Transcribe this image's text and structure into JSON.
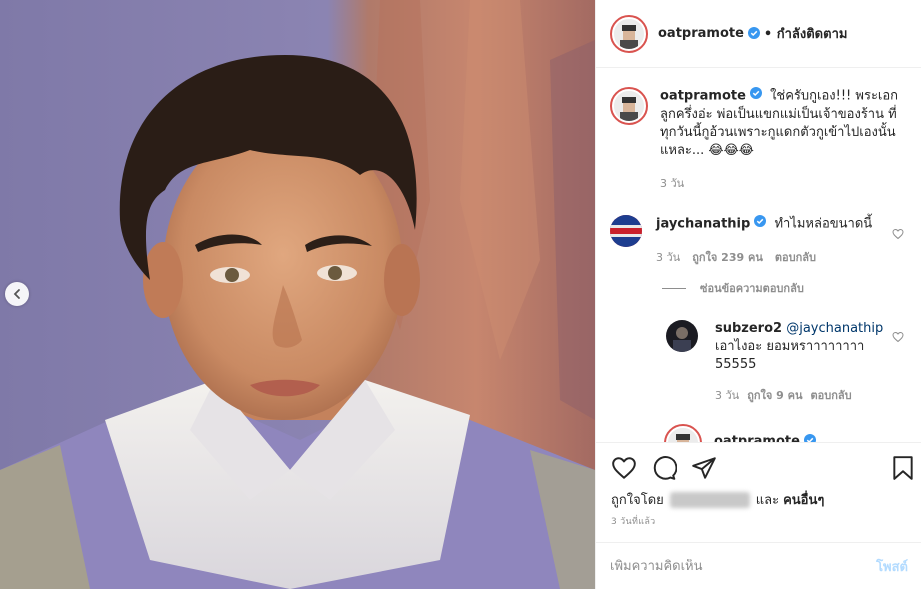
{
  "post": {
    "author": "oatpramote",
    "follow_state": "• กำลังติดตาม",
    "caption": "ใช่ครับกูเอง!!! พระเอกลูกครึ่งอ่ะ พ่อเป็นแขกแม่เป็นเจ้าของร้าน ที่ทุกวันนี้กูอ้วนเพราะกูแดกตัวกูเข้าไปเองนั้นแหละ... 😂😂😂",
    "caption_age": "3 วัน",
    "likes_prefix": "ถูกใจโดย",
    "likes_suffix": "และ",
    "likes_others": "คนอื่นๆ",
    "post_time": "3 วันที่แล้ว"
  },
  "comments": [
    {
      "user": "jaychanathip",
      "text": "ทำไมหล่อขนาดนี้",
      "age": "3 วัน",
      "likes": "ถูกใจ 239 คน",
      "reply": "ตอบกลับ"
    }
  ],
  "hide_replies": "ซ่อนข้อความตอบกลับ",
  "replies": [
    {
      "user": "subzero2",
      "mention": "@jaychanathip",
      "text": "เอาไงอะ ยอมหราาาาาาาา 55555",
      "age": "3 วัน",
      "likes": "ถูกใจ 9 คน",
      "reply": "ตอบกลับ"
    }
  ],
  "next_comment_user": "oatpramote",
  "comment_box": {
    "placeholder": "เพิ่มความคิดเห็น",
    "post_label": "โพสต์"
  },
  "icons": {
    "verified": "verified-badge-icon",
    "like": "heart-icon",
    "comment": "comment-bubble-icon",
    "share": "paper-plane-icon",
    "save": "bookmark-icon",
    "prev": "chevron-left-icon"
  },
  "colors": {
    "verified": "#3897f0",
    "post_button_disabled": "#b3dbff",
    "muted_text": "#8e8e8e",
    "story_ring": "#d9534f"
  }
}
